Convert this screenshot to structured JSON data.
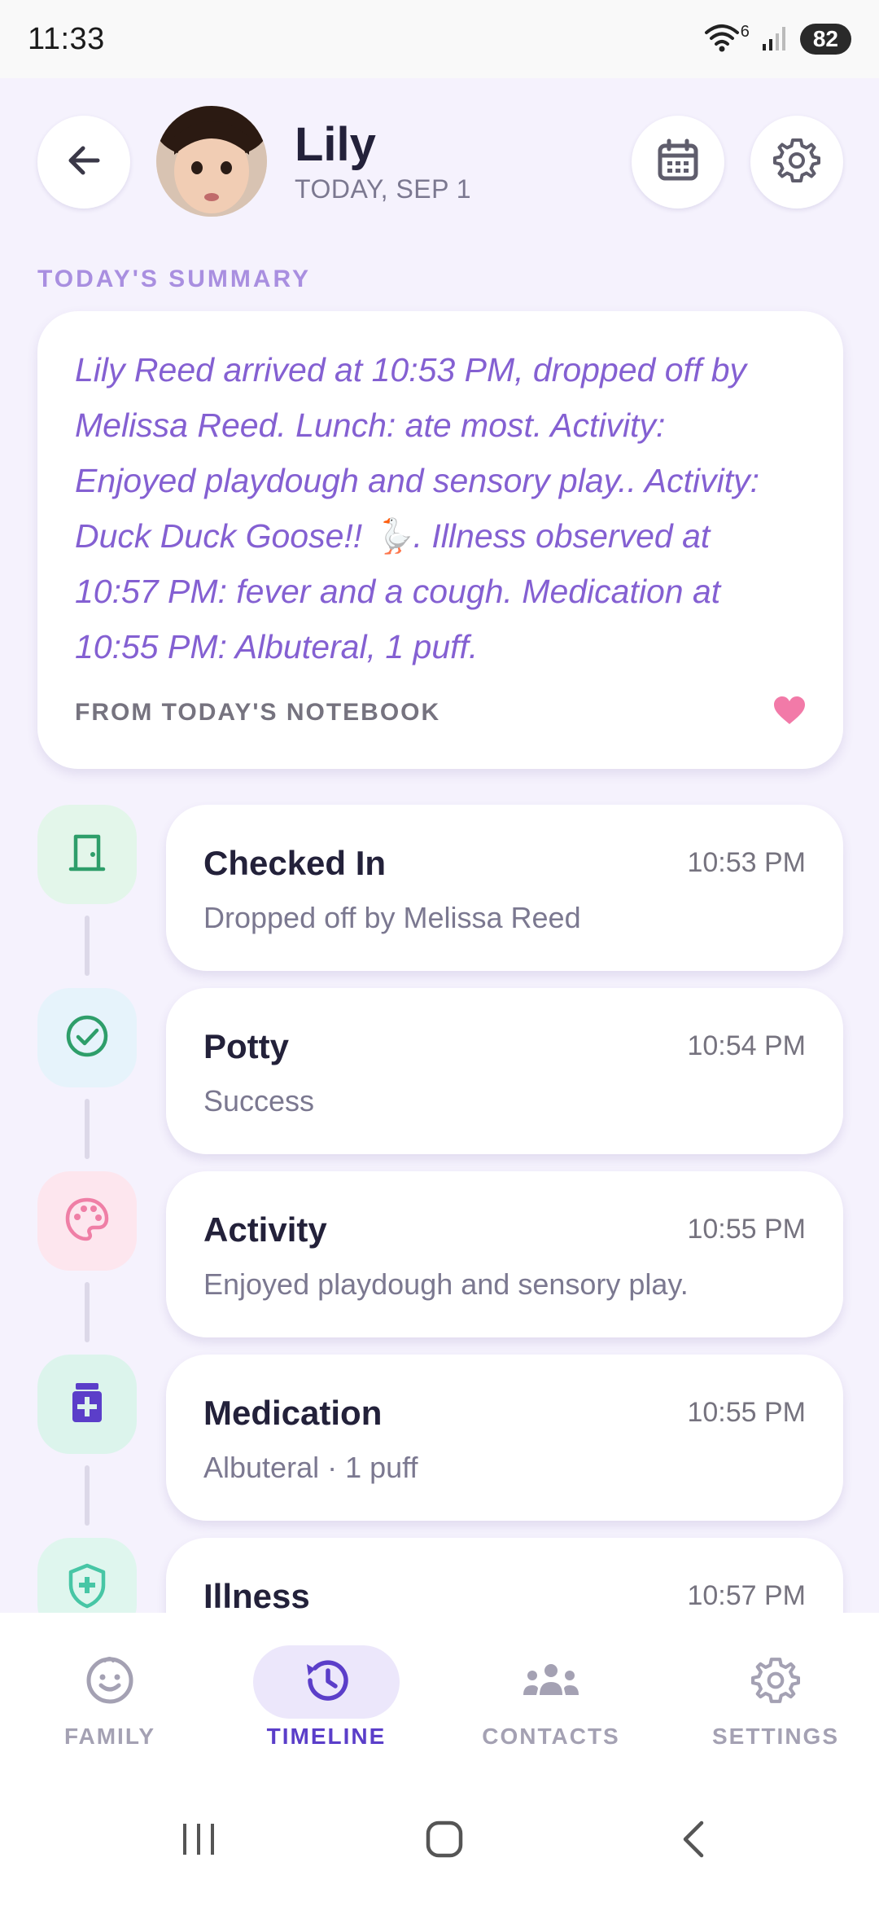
{
  "status_bar": {
    "time": "11:33",
    "wifi_badge": "6",
    "battery": "82"
  },
  "header": {
    "child_name": "Lily",
    "date": "TODAY, SEP 1",
    "back_icon": "arrow-left-icon",
    "calendar_icon": "calendar-icon",
    "settings_icon": "gear-icon"
  },
  "summary": {
    "section_label": "TODAY'S SUMMARY",
    "lines": [
      "Lily Reed arrived at 10:53 PM, dropped off by",
      "Melissa Reed. Lunch: ate most. Activity:",
      "Enjoyed playdough and sensory play.. Activity:",
      "Duck Duck Goose!! 🪿. Illness observed at",
      "10:57 PM: fever and a cough. Medication at",
      "10:55 PM: Albuteral, 1 puff."
    ],
    "footer": "FROM TODAY'S NOTEBOOK"
  },
  "timeline": [
    {
      "title": "Checked In",
      "time": "10:53 PM",
      "detail": "Dropped off by Melissa Reed",
      "icon": "door-icon",
      "color": "#2e9e6a",
      "bg": "#e3f6ea"
    },
    {
      "title": "Potty",
      "time": "10:54 PM",
      "detail": "Success",
      "icon": "check-circle-icon",
      "color": "#2e9e6a",
      "bg": "#e6f3fb"
    },
    {
      "title": "Activity",
      "time": "10:55 PM",
      "detail": "Enjoyed playdough and sensory play.",
      "icon": "palette-icon",
      "color": "#ef7fa6",
      "bg": "#fde6ee"
    },
    {
      "title": "Medication",
      "time": "10:55 PM",
      "detail": "Albuteral · 1 puff",
      "icon": "medicine-icon",
      "color": "#5b3ec9",
      "bg": "#dcf4ec"
    },
    {
      "title": "Illness",
      "time": "10:57 PM",
      "detail": "",
      "icon": "shield-plus-icon",
      "color": "#47c6a5",
      "bg": "#dff6ee"
    }
  ],
  "nav": [
    {
      "label": "FAMILY",
      "icon": "smiley-icon",
      "active": false
    },
    {
      "label": "TIMELINE",
      "icon": "history-icon",
      "active": true
    },
    {
      "label": "CONTACTS",
      "icon": "group-icon",
      "active": false
    },
    {
      "label": "SETTINGS",
      "icon": "gear-icon",
      "active": false
    }
  ],
  "colors": {
    "accent": "#5b3ec9",
    "summary_text": "#8460d2",
    "heart": "#f27aa8"
  }
}
